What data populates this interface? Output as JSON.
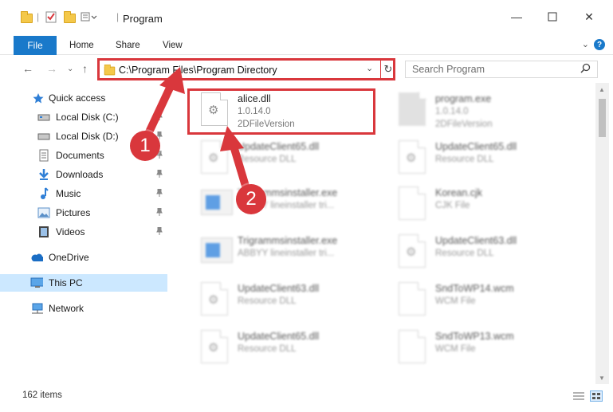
{
  "window": {
    "title": "Program"
  },
  "ribbon": {
    "tabs": [
      "File",
      "Home",
      "Share",
      "View"
    ]
  },
  "nav": {
    "address": "C:\\Program Files\\Program Directory",
    "search_placeholder": "Search Program"
  },
  "sidebar": {
    "items": [
      {
        "label": "Quick access",
        "icon": "star-icon"
      },
      {
        "label": "Local Disk (C:)",
        "icon": "drive-icon"
      },
      {
        "label": "Local Disk (D:)",
        "icon": "drive-icon"
      },
      {
        "label": "Documents",
        "icon": "documents-icon"
      },
      {
        "label": "Downloads",
        "icon": "download-icon"
      },
      {
        "label": "Music",
        "icon": "music-icon"
      },
      {
        "label": "Pictures",
        "icon": "pictures-icon"
      },
      {
        "label": "Videos",
        "icon": "videos-icon"
      },
      {
        "label": "OneDrive",
        "icon": "cloud-icon"
      },
      {
        "label": "This PC",
        "icon": "computer-icon"
      },
      {
        "label": "Network",
        "icon": "network-icon"
      }
    ]
  },
  "files": [
    {
      "name": "alice.dll",
      "line2": "1.0.14.0",
      "line3": "2DFileVersion"
    },
    {
      "name": "program.exe",
      "line2": "1.0.14.0",
      "line3": "2DFileVersion"
    },
    {
      "name": "UpdateClient65.dll",
      "line2": "Resource DLL",
      "line3": ""
    },
    {
      "name": "UpdateClient65.dll",
      "line2": "Resource DLL",
      "line3": ""
    },
    {
      "name": "Trigrammsinstaller.exe",
      "line2": "ABBYY lineinstaller tri...",
      "line3": ""
    },
    {
      "name": "Korean.cjk",
      "line2": "CJK File",
      "line3": ""
    },
    {
      "name": "Trigrammsinstaller.exe",
      "line2": "ABBYY lineinstaller tri...",
      "line3": ""
    },
    {
      "name": "UpdateClient63.dll",
      "line2": "Resource DLL",
      "line3": ""
    },
    {
      "name": "UpdateClient63.dll",
      "line2": "Resource DLL",
      "line3": ""
    },
    {
      "name": "SndToWP14.wcm",
      "line2": "WCM File",
      "line3": ""
    },
    {
      "name": "UpdateClient65.dll",
      "line2": "Resource DLL",
      "line3": ""
    },
    {
      "name": "SndToWP13.wcm",
      "line2": "WCM File",
      "line3": ""
    }
  ],
  "status": {
    "count": "162 items"
  },
  "annotations": {
    "marker1": "1",
    "marker2": "2",
    "accent": "#d9373c"
  }
}
